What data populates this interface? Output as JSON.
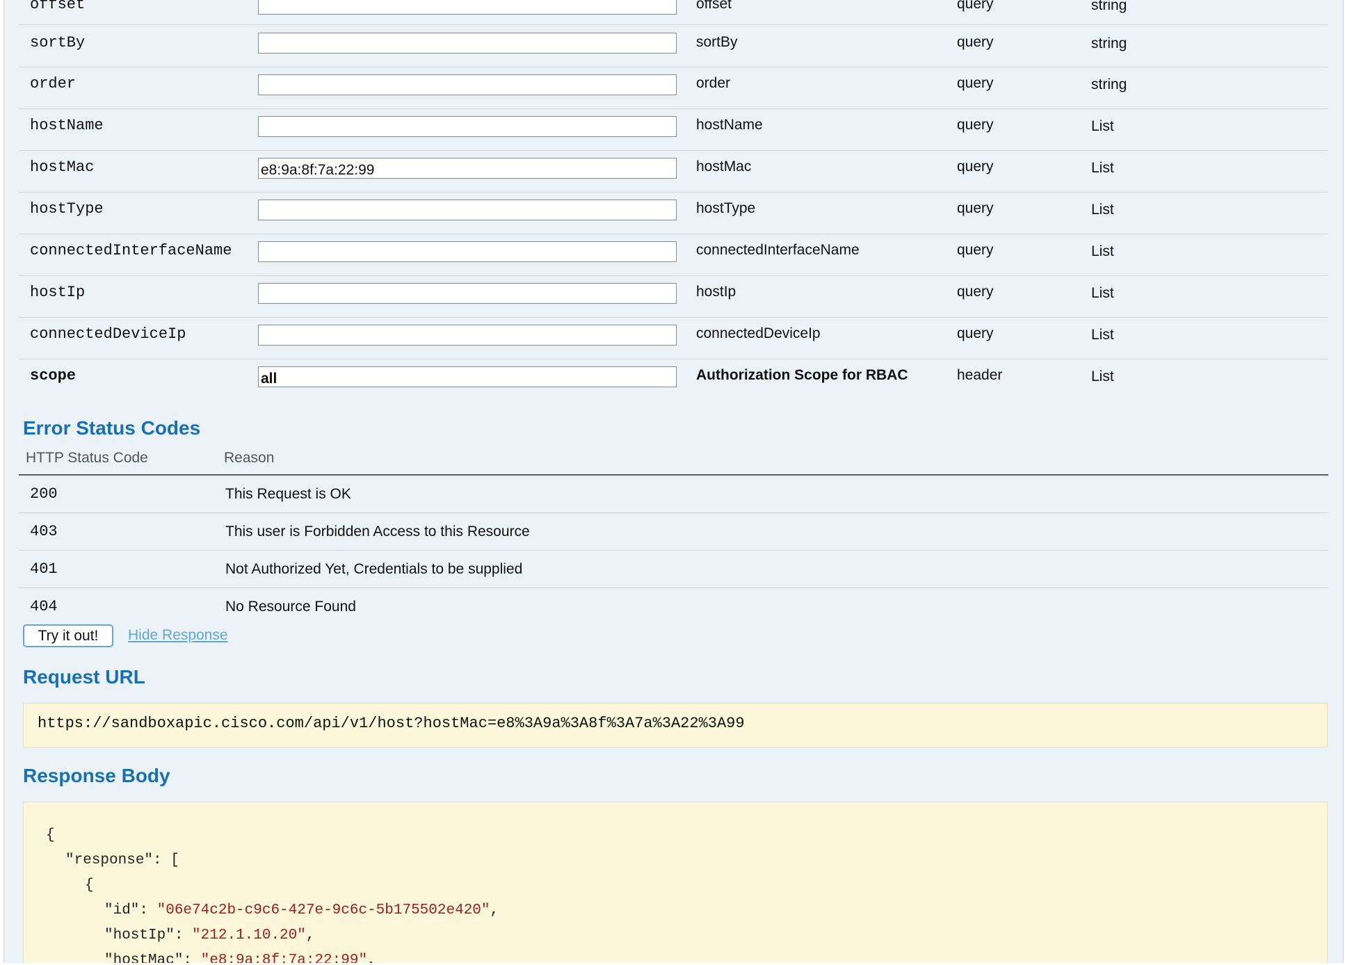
{
  "parameters": [
    {
      "name": "offset",
      "value": "",
      "description": "offset",
      "param_type": "query",
      "data_type": "string"
    },
    {
      "name": "sortBy",
      "value": "",
      "description": "sortBy",
      "param_type": "query",
      "data_type": "string"
    },
    {
      "name": "order",
      "value": "",
      "description": "order",
      "param_type": "query",
      "data_type": "string"
    },
    {
      "name": "hostName",
      "value": "",
      "description": "hostName",
      "param_type": "query",
      "data_type": "List"
    },
    {
      "name": "hostMac",
      "value": "e8:9a:8f:7a:22:99",
      "description": "hostMac",
      "param_type": "query",
      "data_type": "List"
    },
    {
      "name": "hostType",
      "value": "",
      "description": "hostType",
      "param_type": "query",
      "data_type": "List"
    },
    {
      "name": "connectedInterfaceName",
      "value": "",
      "description": "connectedInterfaceName",
      "param_type": "query",
      "data_type": "List"
    },
    {
      "name": "hostIp",
      "value": "",
      "description": "hostIp",
      "param_type": "query",
      "data_type": "List"
    },
    {
      "name": "connectedDeviceIp",
      "value": "",
      "description": "connectedDeviceIp",
      "param_type": "query",
      "data_type": "List"
    },
    {
      "name": "scope",
      "value": "all",
      "description": "Authorization Scope for RBAC",
      "param_type": "header",
      "data_type": "List"
    }
  ],
  "error_codes": {
    "title": "Error Status Codes",
    "columns": [
      "HTTP Status Code",
      "Reason"
    ],
    "rows": [
      {
        "code": "200",
        "reason": "This Request is OK"
      },
      {
        "code": "403",
        "reason": "This user is Forbidden Access to this Resource"
      },
      {
        "code": "401",
        "reason": "Not Authorized Yet, Credentials to be supplied"
      },
      {
        "code": "404",
        "reason": "No Resource Found"
      }
    ]
  },
  "actions": {
    "try_label": "Try it out!",
    "hide_response_label": "Hide Response"
  },
  "request": {
    "title": "Request URL",
    "url": "https://sandboxapic.cisco.com/api/v1/host?hostMac=e8%3A9a%3A8f%3A7a%3A22%3A99"
  },
  "response": {
    "title": "Response Body",
    "lines": {
      "open_brace": "{",
      "response_key": "\"response\": [",
      "item_open": "{",
      "id_key": "\"id\": ",
      "id_value": "\"06e74c2b-c9c6-427e-9c6c-5b175502e420\"",
      "host_ip_key": "\"hostIp\": ",
      "host_ip_value": "\"212.1.10.20\"",
      "host_mac_key": "\"hostMac\": ",
      "host_mac_value": "\"e8:9a:8f:7a:22:99\"",
      "comma": ","
    }
  },
  "colors": {
    "panel_bg": "#ebf3f9",
    "heading": "#1a6fb3",
    "link": "#5ea6db",
    "code_bg": "#fcf6db",
    "json_string": "#9b1c1c"
  }
}
